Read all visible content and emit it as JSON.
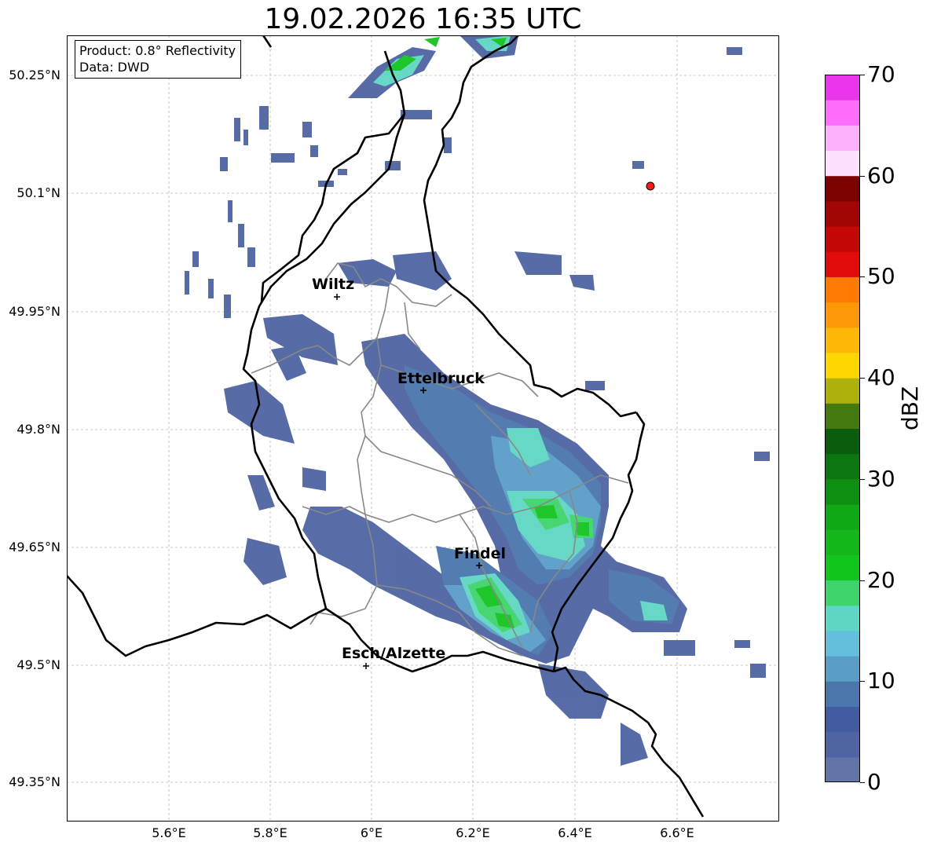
{
  "title": "19.02.2026 16:35 UTC",
  "info_box": {
    "product": "Product: 0.8° Reflectivity",
    "data": "Data: DWD"
  },
  "lat_ticks": [
    "50.25°N",
    "50.1°N",
    "49.95°N",
    "49.8°N",
    "49.65°N",
    "49.5°N",
    "49.35°N"
  ],
  "lon_ticks": [
    "5.6°E",
    "5.8°E",
    "6°E",
    "6.2°E",
    "6.4°E",
    "6.6°E"
  ],
  "cities": [
    {
      "name": "Wiltz"
    },
    {
      "name": "Ettelbruck"
    },
    {
      "name": "Findel"
    },
    {
      "name": "Esch/Alzette"
    }
  ],
  "colorbar": {
    "label": "dBZ",
    "ticks": [
      "0",
      "10",
      "20",
      "30",
      "40",
      "50",
      "60",
      "70"
    ],
    "colors": [
      "#6374a9",
      "#4f64a2",
      "#425c9f",
      "#4a76ad",
      "#5a9ec8",
      "#63bfdc",
      "#5fd6c4",
      "#3ed46b",
      "#12c41e",
      "#13b719",
      "#11a815",
      "#0f8f12",
      "#0c7611",
      "#095d0c",
      "#457a11",
      "#aeb10b",
      "#fed703",
      "#fdb707",
      "#fd9906",
      "#fd7b02",
      "#e10b0b",
      "#c30807",
      "#a10504",
      "#7b0302",
      "#fde1fc",
      "#fdb1fd",
      "#fd6dfc",
      "#e936ea"
    ]
  },
  "marker_color": "#ff1a1a"
}
